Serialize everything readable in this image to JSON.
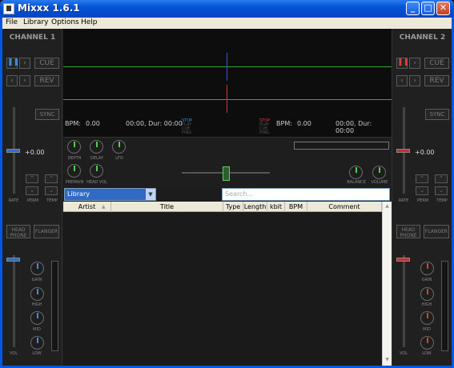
{
  "window": {
    "title": "Mixxx 1.6.1",
    "min_glyph": "_",
    "max_glyph": "□",
    "close_glyph": "✕"
  },
  "menu": [
    "File",
    "Library",
    "Options",
    "Help"
  ],
  "left_deck": {
    "title": "CHANNEL 1",
    "cue": "CUE",
    "rev": "REV",
    "sync": "SYNC",
    "rate_value": "+0.00",
    "rate_label": "RATE",
    "perm_label": "PERM",
    "temp_label": "TEMP",
    "headphones": "HEAD\nPHONE",
    "flanger": "FLANGER",
    "gain": "GAIN",
    "high": "HIGH",
    "mid": "MID",
    "low": "LOW",
    "vol": "VOL",
    "accent": "#3b8ee8"
  },
  "right_deck": {
    "title": "CHANNEL 2",
    "cue": "CUE",
    "rev": "REV",
    "sync": "SYNC",
    "rate_value": "+0.00",
    "rate_label": "RATE",
    "perm_label": "PERM",
    "temp_label": "TEMP",
    "headphones": "HEAD\nPHONE",
    "flanger": "FLANGER",
    "gain": "GAIN",
    "high": "HIGH",
    "mid": "MID",
    "low": "LOW",
    "vol": "VOL",
    "accent": "#e03b3b"
  },
  "waveform": {
    "left": {
      "bpm_label": "BPM:",
      "bpm": "0.00",
      "time": "00:00, Dur: 00:00",
      "status": [
        "STOP",
        "PLAY",
        "CUE",
        "PING"
      ]
    },
    "right": {
      "bpm_label": "BPM:",
      "bpm": "0.00",
      "time": "00:00, Dur: 00:00",
      "status": [
        "STOP",
        "PLAY",
        "CUE",
        "PING"
      ]
    }
  },
  "mixer": {
    "depth": "DEPTH",
    "delay": "DELAY",
    "lfo": "LFO",
    "premain": "PREMAIN",
    "headvol": "HEAD VOL",
    "balance": "BALANCE",
    "volume": "VOLUME"
  },
  "library": {
    "selected": "Library",
    "dropdown_icon": "chevron-down-icon",
    "search_placeholder": "Search...",
    "columns": [
      "Artist",
      "Title",
      "Type",
      "Length",
      "kbit",
      "BPM",
      "Comment"
    ]
  }
}
